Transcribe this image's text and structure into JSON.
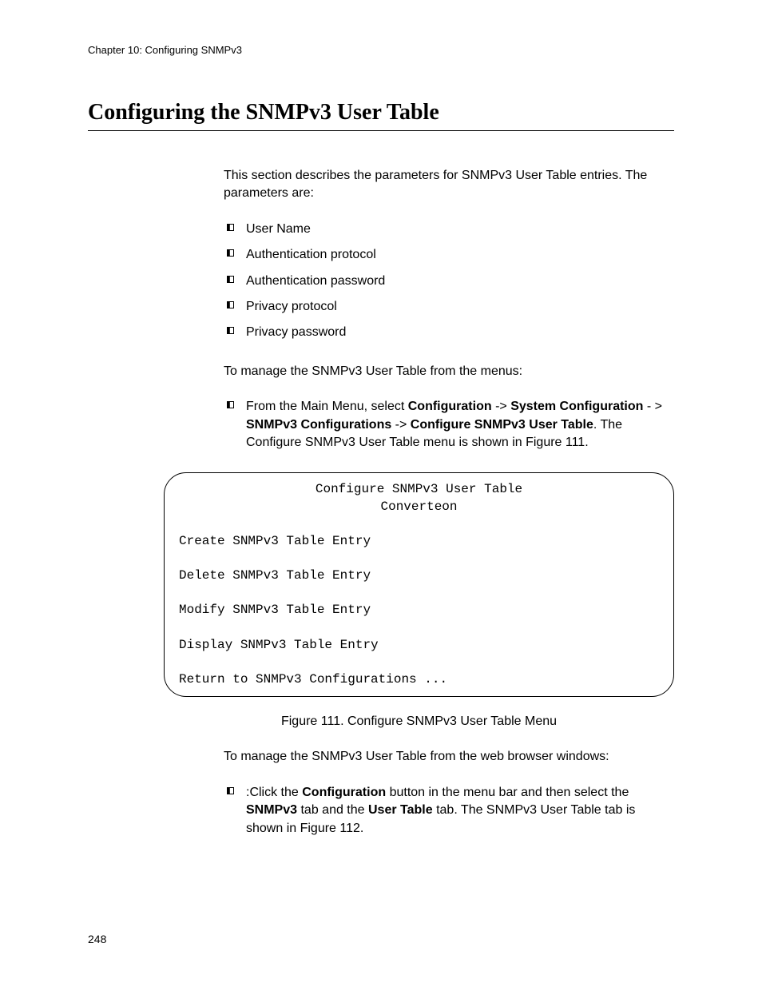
{
  "header": {
    "chapter": "Chapter 10: Configuring SNMPv3"
  },
  "title": "Configuring the SNMPv3 User Table",
  "intro": "This section describes the parameters for SNMPv3 User Table entries. The parameters are:",
  "param_bullets": [
    "User Name",
    "Authentication protocol",
    "Authentication password",
    "Privacy protocol",
    "Privacy password"
  ],
  "manage_menu_intro": "To manage the SNMPv3 User Table from the menus:",
  "menu_nav": {
    "prefix": "From the Main Menu, select ",
    "b1": "Configuration",
    "arrow1": " -> ",
    "b2": "System Configuration",
    "mid": " - > ",
    "b3": "SNMPv3 Configurations",
    "arrow2": " -> ",
    "b4": "Configure SNMPv3 User Table",
    "suffix": ". The Configure SNMPv3 User Table menu is shown in Figure 111."
  },
  "menu_box": {
    "title": "Configure SNMPv3 User Table",
    "subtitle": "Converteon",
    "items": [
      "Create SNMPv3 Table Entry",
      "Delete SNMPv3 Table Entry",
      "Modify SNMPv3 Table Entry",
      "Display SNMPv3 Table Entry",
      "Return to SNMPv3 Configurations ..."
    ]
  },
  "figure_caption": "Figure 111. Configure SNMPv3 User Table Menu",
  "manage_web_intro": "To manage the SNMPv3 User Table from the web browser windows:",
  "web_nav": {
    "prefix": ":Click the ",
    "b1": "Configuration",
    "mid1": " button in the menu bar and then select the ",
    "b2": "SNMPv3",
    "mid2": " tab and the ",
    "b3": "User Table",
    "suffix": " tab. The SNMPv3 User Table tab is shown in Figure 112."
  },
  "page_number": "248"
}
